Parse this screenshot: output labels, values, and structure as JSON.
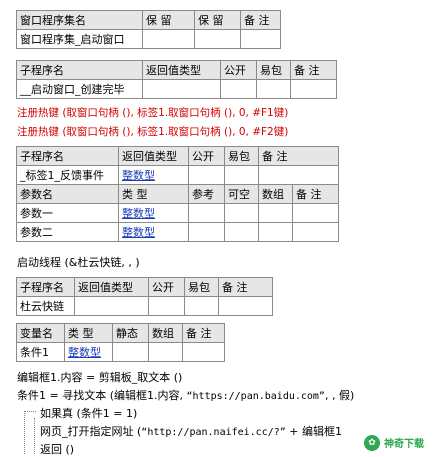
{
  "window_table": {
    "headers": [
      "窗口程序集名",
      "保 留",
      "保 留",
      "备 注"
    ],
    "row": [
      "窗口程序集_启动窗口",
      "",
      "",
      ""
    ]
  },
  "sub1": {
    "headers": [
      "子程序名",
      "返回值类型",
      "公开",
      "易包",
      "备 注"
    ],
    "row": [
      "__启动窗口_创建完毕",
      "",
      "",
      "",
      ""
    ]
  },
  "hotkey_lines": [
    "注册热键 (取窗口句柄 (), 标签1.取窗口句柄 (), 0, #F1键)",
    "注册热键 (取窗口句柄 (), 标签1.取窗口句柄 (), 0, #F2键)"
  ],
  "sub2": {
    "headers": [
      "子程序名",
      "返回值类型",
      "公开",
      "易包",
      "备 注"
    ],
    "row": [
      "_标签1_反馈事件",
      "整数型",
      "",
      "",
      ""
    ],
    "param_headers": [
      "参数名",
      "类 型",
      "参考",
      "可空",
      "数组",
      "备 注"
    ],
    "params": [
      [
        "参数一",
        "整数型",
        "",
        "",
        "",
        ""
      ],
      [
        "参数二",
        "整数型",
        "",
        "",
        "",
        ""
      ]
    ]
  },
  "thread_line": "启动线程 (&杜云快链, , )",
  "sub3": {
    "headers": [
      "子程序名",
      "返回值类型",
      "公开",
      "易包",
      "备 注"
    ],
    "row": [
      "杜云快链",
      "",
      "",
      "",
      ""
    ]
  },
  "var_table": {
    "headers": [
      "变量名",
      "类 型",
      "静态",
      "数组",
      "备 注"
    ],
    "row": [
      "条件1",
      "整数型",
      "",
      "",
      ""
    ]
  },
  "code": {
    "line1": "编辑框1.内容 = 剪辑板_取文本 ()",
    "line2_a": "条件1 = 寻找文本 (编辑框1.内容, ",
    "line2_str": "“https://pan.baidu.com”",
    "line2_b": ", , 假)",
    "line3": "如果真 (条件1 = 1)",
    "line4_a": "网页_打开指定网址 (",
    "line4_str": "“http://pan.naifei.cc/?”",
    "line4_b": " + 编辑框1",
    "line5": "返回 ()"
  },
  "watermark": {
    "text": "神奇下载",
    "icon": "leaf-icon"
  }
}
